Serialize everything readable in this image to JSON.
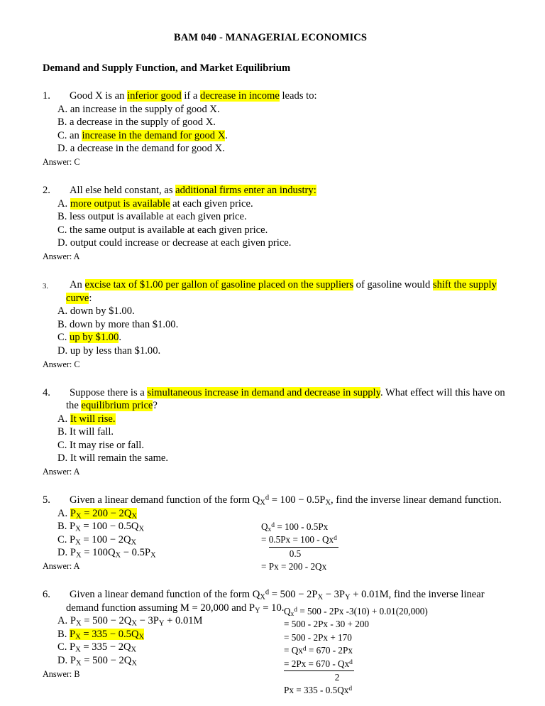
{
  "document": {
    "title": "BAM 040 - MANAGERIAL ECONOMICS",
    "section_heading": "Demand and Supply Function, and Market Equilibrium",
    "highlight_color": "#ffff00",
    "text_color": "#000000",
    "page_background": "#ffffff"
  },
  "questions": [
    {
      "number": "1.",
      "stem_parts": [
        {
          "t": "Good X is an ",
          "hl": false
        },
        {
          "t": "inferior good",
          "hl": true
        },
        {
          "t": " if a ",
          "hl": false
        },
        {
          "t": "decrease in income",
          "hl": true
        },
        {
          "t": " leads to:",
          "hl": false
        }
      ],
      "options": [
        {
          "label": "A.",
          "parts": [
            {
              "t": " an increase in the supply of good X.",
              "hl": false
            }
          ]
        },
        {
          "label": "B.",
          "parts": [
            {
              "t": " a decrease in the supply of good X.",
              "hl": false
            }
          ]
        },
        {
          "label": "C.",
          "parts": [
            {
              "t": " an ",
              "hl": false
            },
            {
              "t": "increase in the demand for good X",
              "hl": true
            },
            {
              "t": ".",
              "hl": false
            }
          ]
        },
        {
          "label": "D.",
          "parts": [
            {
              "t": " a decrease in the demand for good X.",
              "hl": false
            }
          ]
        }
      ],
      "answer": "Answer: C"
    },
    {
      "number": "2.",
      "stem_parts": [
        {
          "t": "All else held constant, as ",
          "hl": false
        },
        {
          "t": "additional firms enter an industry:",
          "hl": true
        }
      ],
      "options": [
        {
          "label": "A.",
          "parts": [
            {
              "t": " ",
              "hl": false
            },
            {
              "t": "more output is available",
              "hl": true
            },
            {
              "t": " at each given price.",
              "hl": false
            }
          ]
        },
        {
          "label": "B.",
          "parts": [
            {
              "t": " less output is available at each given price.",
              "hl": false
            }
          ]
        },
        {
          "label": "C.",
          "parts": [
            {
              "t": " the same output is available at each given price.",
              "hl": false
            }
          ]
        },
        {
          "label": "D.",
          "parts": [
            {
              "t": " output could increase or decrease at each given price.",
              "hl": false
            }
          ]
        }
      ],
      "answer": "Answer: A"
    },
    {
      "number": "3.",
      "number_small": true,
      "stem_parts": [
        {
          "t": "An ",
          "hl": false
        },
        {
          "t": "excise tax of $1.00 per gallon of gasoline placed on the suppliers",
          "hl": true
        },
        {
          "t": " of gasoline would ",
          "hl": false
        },
        {
          "t": "shift the supply curve",
          "hl": true
        },
        {
          "t": ":",
          "hl": false
        }
      ],
      "options": [
        {
          "label": "A.",
          "parts": [
            {
              "t": " down by $1.00.",
              "hl": false
            }
          ]
        },
        {
          "label": "B.",
          "parts": [
            {
              "t": " down by more than $1.00.",
              "hl": false
            }
          ]
        },
        {
          "label": "C.",
          "parts": [
            {
              "t": " ",
              "hl": false
            },
            {
              "t": "up by $1.00",
              "hl": true
            },
            {
              "t": ".",
              "hl": false
            }
          ]
        },
        {
          "label": "D.",
          "parts": [
            {
              "t": " up by less than $1.00.",
              "hl": false
            }
          ]
        }
      ],
      "answer": "Answer: C"
    },
    {
      "number": "4.",
      "stem_parts": [
        {
          "t": "Suppose there is a ",
          "hl": false
        },
        {
          "t": "simultaneous increase in demand and decrease in supply",
          "hl": true
        },
        {
          "t": ". What effect will this have on the ",
          "hl": false
        },
        {
          "t": "equilibrium price",
          "hl": true
        },
        {
          "t": "?",
          "hl": false
        }
      ],
      "options": [
        {
          "label": "A.",
          "parts": [
            {
              "t": " ",
              "hl": false
            },
            {
              "t": "It will rise.",
              "hl": true
            }
          ]
        },
        {
          "label": "B.",
          "parts": [
            {
              "t": " It will fall.",
              "hl": false
            }
          ]
        },
        {
          "label": "C.",
          "parts": [
            {
              "t": " It may rise or fall.",
              "hl": false
            }
          ]
        },
        {
          "label": "D.",
          "parts": [
            {
              "t": " It will remain the same.",
              "hl": false
            }
          ]
        }
      ],
      "answer": "Answer: A"
    },
    {
      "number": "5.",
      "stem_parts": [
        {
          "t": "Given a linear demand function of the form Q",
          "hl": false
        },
        {
          "t": "X",
          "hl": false,
          "sub": true
        },
        {
          "t": "d",
          "hl": false,
          "sup": true
        },
        {
          "t": " = 100 − 0.5P",
          "hl": false
        },
        {
          "t": "X",
          "hl": false,
          "sub": true
        },
        {
          "t": ", find the inverse linear demand function.",
          "hl": false
        }
      ],
      "options": [
        {
          "label": "A.",
          "parts": [
            {
              "t": " ",
              "hl": false
            },
            {
              "t": "P",
              "hl": true
            },
            {
              "t": "X",
              "hl": true,
              "sub": true
            },
            {
              "t": " = 200 − 2Q",
              "hl": true
            },
            {
              "t": "X",
              "hl": true,
              "sub": true
            }
          ]
        },
        {
          "label": "B.",
          "parts": [
            {
              "t": " P",
              "hl": false
            },
            {
              "t": "X",
              "hl": false,
              "sub": true
            },
            {
              "t": " = 100 − 0.5Q",
              "hl": false
            },
            {
              "t": "X",
              "hl": false,
              "sub": true
            }
          ]
        },
        {
          "label": "C.",
          "parts": [
            {
              "t": " P",
              "hl": false
            },
            {
              "t": "X",
              "hl": false,
              "sub": true
            },
            {
              "t": " = 100 − 2Q",
              "hl": false
            },
            {
              "t": "X",
              "hl": false,
              "sub": true
            }
          ]
        },
        {
          "label": "D.",
          "parts": [
            {
              "t": " P",
              "hl": false
            },
            {
              "t": "X",
              "hl": false,
              "sub": true
            },
            {
              "t": " = 100Q",
              "hl": false
            },
            {
              "t": "X",
              "hl": false,
              "sub": true
            },
            {
              "t": " − 0.5P",
              "hl": false
            },
            {
              "t": "X",
              "hl": false,
              "sub": true
            }
          ]
        }
      ],
      "answer": "Answer: A"
    },
    {
      "number": "6.",
      "stem_parts": [
        {
          "t": "Given a linear demand function of the form Q",
          "hl": false
        },
        {
          "t": "X",
          "hl": false,
          "sub": true
        },
        {
          "t": "d",
          "hl": false,
          "sup": true
        },
        {
          "t": " = 500 − 2P",
          "hl": false
        },
        {
          "t": "X",
          "hl": false,
          "sub": true
        },
        {
          "t": " − 3P",
          "hl": false
        },
        {
          "t": "Y",
          "hl": false,
          "sub": true
        },
        {
          "t": " + 0.01M, find the inverse linear demand function assuming M = 20,000 and P",
          "hl": false
        },
        {
          "t": "Y",
          "hl": false,
          "sub": true
        },
        {
          "t": " = 10.",
          "hl": false
        }
      ],
      "options": [
        {
          "label": "A.",
          "parts": [
            {
              "t": " P",
              "hl": false
            },
            {
              "t": "X",
              "hl": false,
              "sub": true
            },
            {
              "t": " = 500 − 2Q",
              "hl": false
            },
            {
              "t": "X",
              "hl": false,
              "sub": true
            },
            {
              "t": " − 3P",
              "hl": false
            },
            {
              "t": "Y",
              "hl": false,
              "sub": true
            },
            {
              "t": " + 0.01M",
              "hl": false
            }
          ]
        },
        {
          "label": "B.",
          "parts": [
            {
              "t": " ",
              "hl": false
            },
            {
              "t": "P",
              "hl": true
            },
            {
              "t": "X",
              "hl": true,
              "sub": true
            },
            {
              "t": " = 335 − 0.5Q",
              "hl": true
            },
            {
              "t": "X",
              "hl": true,
              "sub": true
            }
          ]
        },
        {
          "label": "C.",
          "parts": [
            {
              "t": " P",
              "hl": false
            },
            {
              "t": "X",
              "hl": false,
              "sub": true
            },
            {
              "t": " = 335 − 2Q",
              "hl": false
            },
            {
              "t": "X",
              "hl": false,
              "sub": true
            }
          ]
        },
        {
          "label": "D.",
          "parts": [
            {
              "t": " P",
              "hl": false
            },
            {
              "t": "X",
              "hl": false,
              "sub": true
            },
            {
              "t": " = 500 − 2Q",
              "hl": false
            },
            {
              "t": "X",
              "hl": false,
              "sub": true
            }
          ]
        }
      ],
      "answer": "Answer: B"
    }
  ],
  "worked_solutions": {
    "q5": {
      "lines": [
        {
          "kind": "plain",
          "parts": [
            {
              "t": "Q"
            },
            {
              "t": "x",
              "sub": true
            },
            {
              "t": "d",
              "sup": true
            },
            {
              "t": " = 100 - 0.5Px"
            }
          ]
        },
        {
          "kind": "fraction_numerator",
          "parts": [
            {
              "t": "= "
            },
            {
              "t": "0.5Px = 100 - Qx",
              "frac": true
            },
            {
              "t": "d",
              "sup": true,
              "frac": true
            }
          ]
        },
        {
          "kind": "denominator",
          "parts": [
            {
              "t": "0.5"
            }
          ]
        },
        {
          "kind": "plain",
          "parts": [
            {
              "t": "= Px = 200 - 2Qx"
            }
          ]
        }
      ]
    },
    "q6": {
      "lines": [
        {
          "kind": "plain",
          "parts": [
            {
              "t": "Q"
            },
            {
              "t": "x",
              "sub": true
            },
            {
              "t": "d",
              "sup": true
            },
            {
              "t": " = 500 - 2Px -3(10) + 0.01(20,000)"
            }
          ]
        },
        {
          "kind": "plain",
          "parts": [
            {
              "t": "= 500 - 2Px - 30 + 200"
            }
          ]
        },
        {
          "kind": "plain",
          "parts": [
            {
              "t": "= 500 - 2Px + 170"
            }
          ]
        },
        {
          "kind": "plain",
          "parts": [
            {
              "t": "= Qx"
            },
            {
              "t": "d",
              "sup": true
            },
            {
              "t": " = 670 - 2Px"
            }
          ]
        },
        {
          "kind": "fraction_numerator",
          "parts": [
            {
              "t": "= 2Px = 670 - Qx",
              "frac": true
            },
            {
              "t": "d",
              "sup": true,
              "frac": true
            }
          ]
        },
        {
          "kind": "denominator",
          "parts": [
            {
              "t": "2"
            }
          ]
        },
        {
          "kind": "plain",
          "parts": [
            {
              "t": "Px = 335 - 0.5Qx"
            },
            {
              "t": "d",
              "sup": true
            }
          ]
        }
      ]
    }
  }
}
